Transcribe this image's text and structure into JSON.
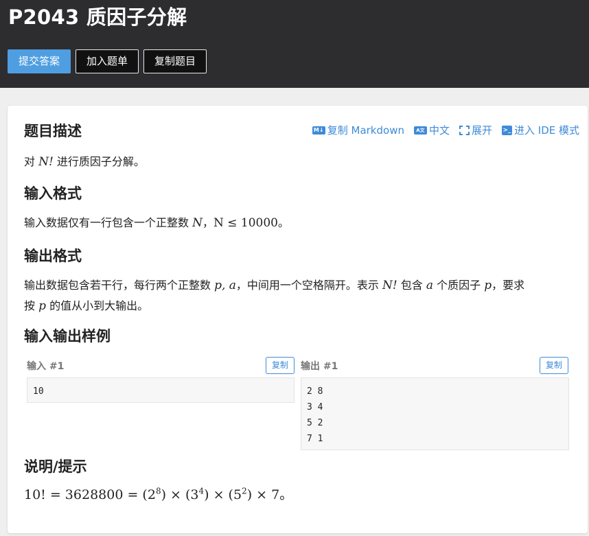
{
  "header": {
    "title": "P2043 质因子分解",
    "buttons": {
      "submit": "提交答案",
      "add_list": "加入题单",
      "copy_problem": "复制题目"
    }
  },
  "tools": {
    "copy_markdown": "复制 Markdown",
    "lang": "中文",
    "expand": "展开",
    "ide": "进入 IDE 模式",
    "md_icon": "M↓",
    "lang_icon": "A文",
    "term_icon": ">_"
  },
  "sections": {
    "description": {
      "heading": "题目描述",
      "t1": "对 ",
      "var_n": "N!",
      "t2": " 进行质因子分解。"
    },
    "input": {
      "heading": "输入格式",
      "t1": "输入数据仅有一行包含一个正整数 ",
      "var_n": "N",
      "t2": "，",
      "cond": "N ≤ 10000",
      "t3": "。"
    },
    "output": {
      "heading": "输出格式",
      "l1a": "输出数据包含若干行，每行两个正整数 ",
      "l1b": "p, a",
      "l1c": "，中间用一个空格隔开。表示 ",
      "l1d": "N!",
      "l1e": " 包含 ",
      "l1f": "a",
      "l1g": " 个质因子 ",
      "l1h": "p",
      "l1i": "，要求",
      "l2a": "按 ",
      "l2b": "p",
      "l2c": " 的值从小到大输出。"
    },
    "samples": {
      "heading": "输入输出样例",
      "input_label": "输入 #1",
      "output_label": "输出 #1",
      "copy": "复制",
      "input_data": "10",
      "output_data": "2 8\n3 4\n5 2\n7 1"
    },
    "hint": {
      "heading": "说明/提示",
      "lhs": "10! = 3628800 = (2",
      "e1": "8",
      "m1": ") × (3",
      "e2": "4",
      "m2": ") × (5",
      "e3": "2",
      "m3": ") × 7。"
    }
  }
}
